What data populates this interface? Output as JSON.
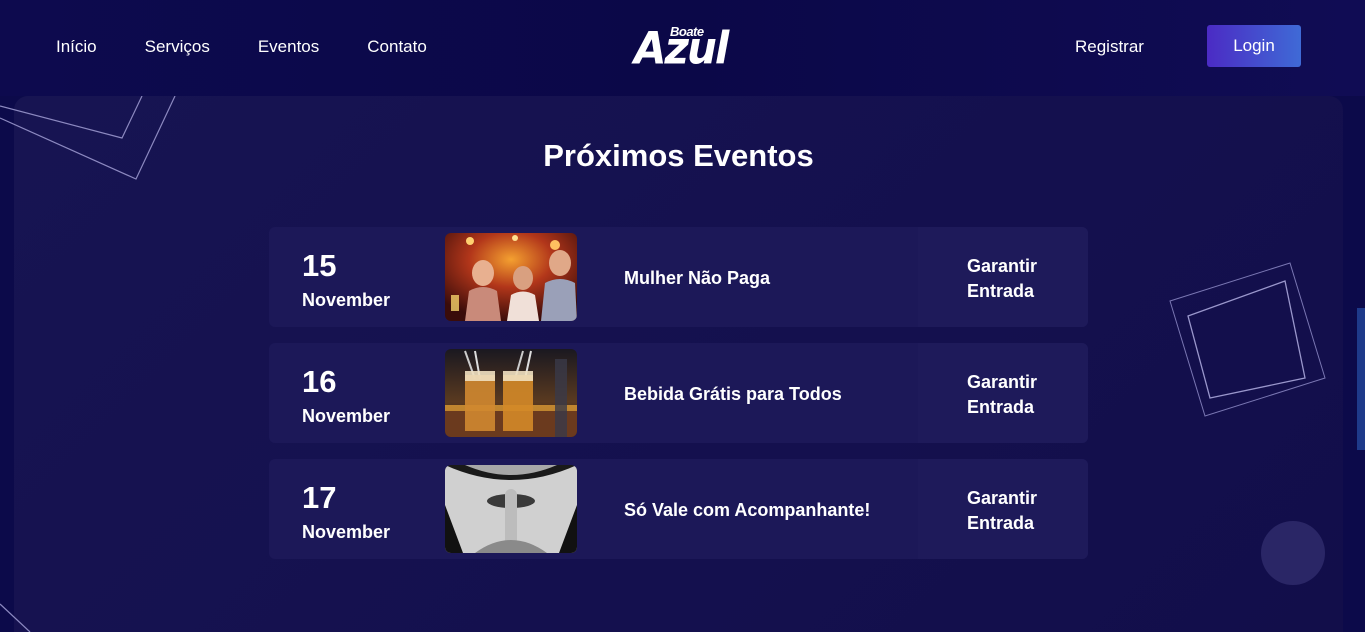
{
  "nav": {
    "items": [
      {
        "label": "Início"
      },
      {
        "label": "Serviços"
      },
      {
        "label": "Eventos"
      },
      {
        "label": "Contato"
      }
    ],
    "register": "Registrar",
    "login": "Login"
  },
  "logo": {
    "top_text": "Boate",
    "main_text": "Azul"
  },
  "section": {
    "title": "Próximos Eventos"
  },
  "events": [
    {
      "day": "15",
      "month": "November",
      "name": "Mulher Não Paga",
      "cta_line1": "Garantir",
      "cta_line2": "Entrada",
      "image": "party-crowd-photo"
    },
    {
      "day": "16",
      "month": "November",
      "name": "Bebida Grátis para Todos",
      "cta_line1": "Garantir",
      "cta_line2": "Entrada",
      "image": "cocktail-glasses-photo"
    },
    {
      "day": "17",
      "month": "November",
      "name": "Só Vale com Acompanhante!",
      "cta_line1": "Garantir",
      "cta_line2": "Entrada",
      "image": "shush-finger-lips-photo"
    }
  ],
  "colors": {
    "background": "#0c0a4a",
    "panel": "#171452",
    "card": "#1c1858",
    "login_gradient_start": "#4b2bc4",
    "login_gradient_end": "#3f6ad6"
  }
}
